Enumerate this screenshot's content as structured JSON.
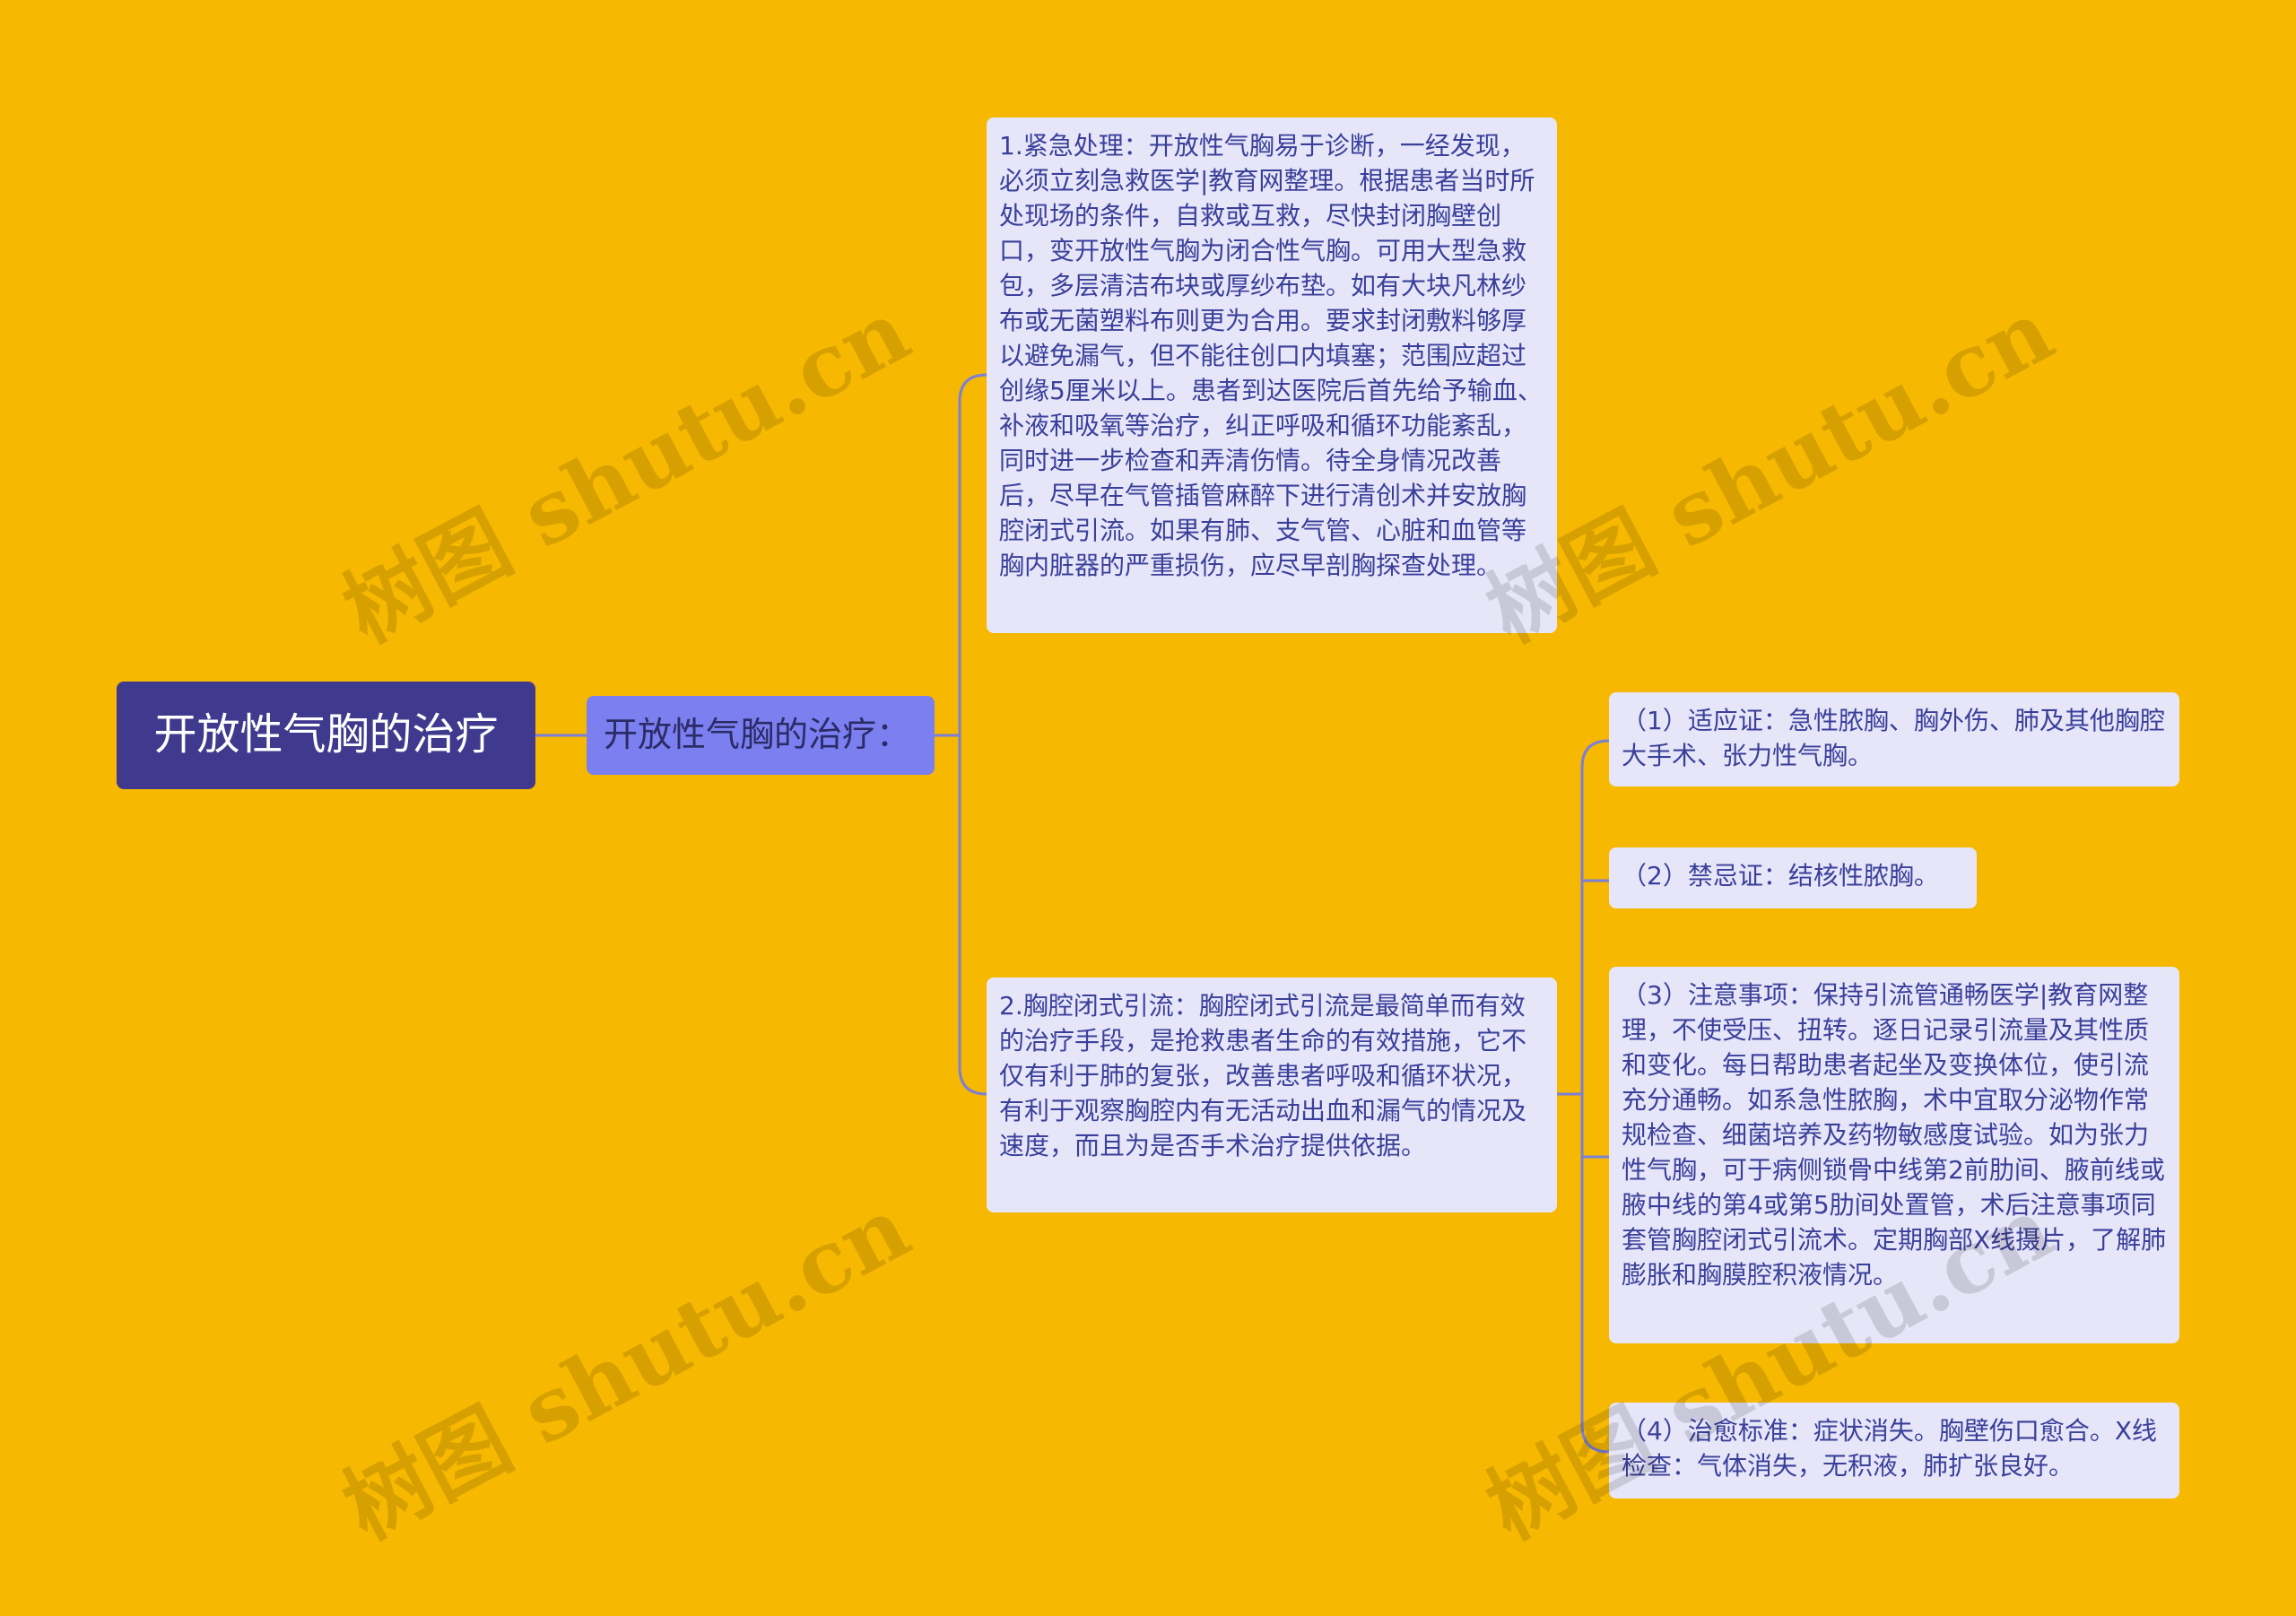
{
  "root": {
    "label": "开放性气胸的治疗"
  },
  "branch": {
    "label": "开放性气胸的治疗："
  },
  "items": [
    {
      "text": "1.紧急处理：开放性气胸易于诊断，一经发现，必须立刻急救医学|教育网整理。根据患者当时所处现场的条件，自救或互救，尽快封闭胸壁创口，变开放性气胸为闭合性气胸。可用大型急救包，多层清洁布块或厚纱布垫。如有大块凡林纱布或无菌塑料布则更为合用。要求封闭敷料够厚以避免漏气，但不能往创口内填塞；范围应超过创缘5厘米以上。患者到达医院后首先给予输血、补液和吸氧等治疗，纠正呼吸和循环功能紊乱，同时进一步检查和弄清伤情。待全身情况改善后，尽早在气管插管麻醉下进行清创术并安放胸腔闭式引流。如果有肺、支气管、心脏和血管等胸内脏器的严重损伤，应尽早剖胸探查处理。"
    },
    {
      "text": "2.胸腔闭式引流：胸腔闭式引流是最简单而有效的治疗手段，是抢救患者生命的有效措施，它不仅有利于肺的复张，改善患者呼吸和循环状况，有利于观察胸腔内有无活动出血和漏气的情况及速度，而且为是否手术治疗提供依据。",
      "children": [
        {
          "text": "（1）适应证：急性脓胸、胸外伤、肺及其他胸腔大手术、张力性气胸。"
        },
        {
          "text": "（2）禁忌证：结核性脓胸。"
        },
        {
          "text": "（3）注意事项：保持引流管通畅医学|教育网整理，不使受压、扭转。逐日记录引流量及其性质和变化。每日帮助患者起坐及变换体位，使引流充分通畅。如系急性脓胸，术中宜取分泌物作常规检查、细菌培养及药物敏感度试验。如为张力性气胸，可于病侧锁骨中线第2前肋间、腋前线或腋中线的第4或第5肋间处置管，术后注意事项同套管胸腔闭式引流术。定期胸部X线摄片，了解肺膨胀和胸膜腔积液情况。"
        },
        {
          "text": "（4）治愈标准：症状消失。胸壁伤口愈合。X线检查：气体消失，无积液，肺扩张良好。"
        }
      ]
    }
  ],
  "watermark": "树图 shutu.cn",
  "colors": {
    "background": "#F6B800",
    "root": "#3F3A8E",
    "branch": "#7B7FF0",
    "card": "#E6E6F8",
    "connector": "#7B7FD8",
    "card_text": "#3A3F9A"
  }
}
